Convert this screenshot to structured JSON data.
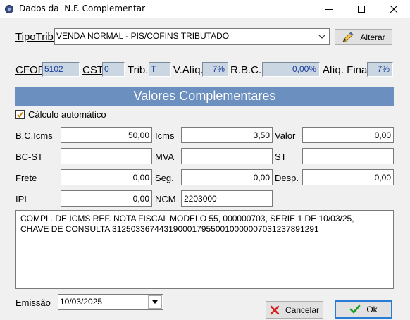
{
  "window": {
    "title": "Dados da  N.F. Complementar"
  },
  "tipo_trib": {
    "label": "TipoTrib.",
    "value": "VENDA NORMAL - PIS/COFINS TRIBUTADO",
    "alterar_label": "Alterar"
  },
  "info_row": {
    "cfop_label": "CFOP",
    "cfop_value": "5102",
    "cst_label": "CST",
    "cst_value": "0",
    "trib_label": "Trib.",
    "trib_value": "T",
    "valiq_label": "V.Alíq.",
    "valiq_value": "7%",
    "rbc_label": "R.B.C.",
    "rbc_value": "0,00%",
    "aliq_final_label": "Alíq. Final",
    "aliq_final_value": "7%"
  },
  "section": {
    "title": "Valores Complementares"
  },
  "calculo_automatico": {
    "label": "Cálculo automático",
    "checked": true
  },
  "fields": {
    "bc_icms_label": "B.C.Icms",
    "bc_icms_value": "50,00",
    "icms_label": "Icms",
    "icms_value": "3,50",
    "valor_label": "Valor",
    "valor_value": "0,00",
    "bc_st_label": "BC-ST",
    "bc_st_value": "",
    "mva_label": "MVA",
    "mva_value": "",
    "st_label": "ST",
    "st_value": "",
    "frete_label": "Frete",
    "frete_value": "0,00",
    "seg_label": "Seg.",
    "seg_value": "0,00",
    "desp_label": "Desp.",
    "desp_value": "0,00",
    "ipi_label": "IPI",
    "ipi_value": "0,00",
    "ncm_label": "NCM",
    "ncm_value": "2203000"
  },
  "memo": {
    "line1": "COMPL. DE ICMS REF. NOTA FISCAL MODELO 55, 000000703, SERIE 1 DE 10/03/25,",
    "line2": "CHAVE DE CONSULTA 31250336744319000179550010000007031237891291"
  },
  "emissao": {
    "label": "Emissão",
    "value": "10/03/2025"
  },
  "buttons": {
    "cancelar_label": "Cancelar",
    "ok_label": "Ok"
  },
  "colors": {
    "section_bar": "#6b8fbf",
    "readonly_bg": "#cad6e1",
    "readonly_text": "#1a3b9a",
    "cancel_icon": "#d42020",
    "ok_icon": "#1e9c2a",
    "default_button_border": "#2a7bd4"
  },
  "icons": {
    "app": "app-icon",
    "minimize": "minimize-icon",
    "maximize": "maximize-icon",
    "close": "close-icon",
    "alterar": "pencil-icon",
    "cancelar": "x-icon",
    "ok": "checkmark-icon",
    "dropdown": "chevron-down-icon",
    "date_dropdown": "dropdown-triangle-icon",
    "checkbox": "checkmark-icon"
  }
}
